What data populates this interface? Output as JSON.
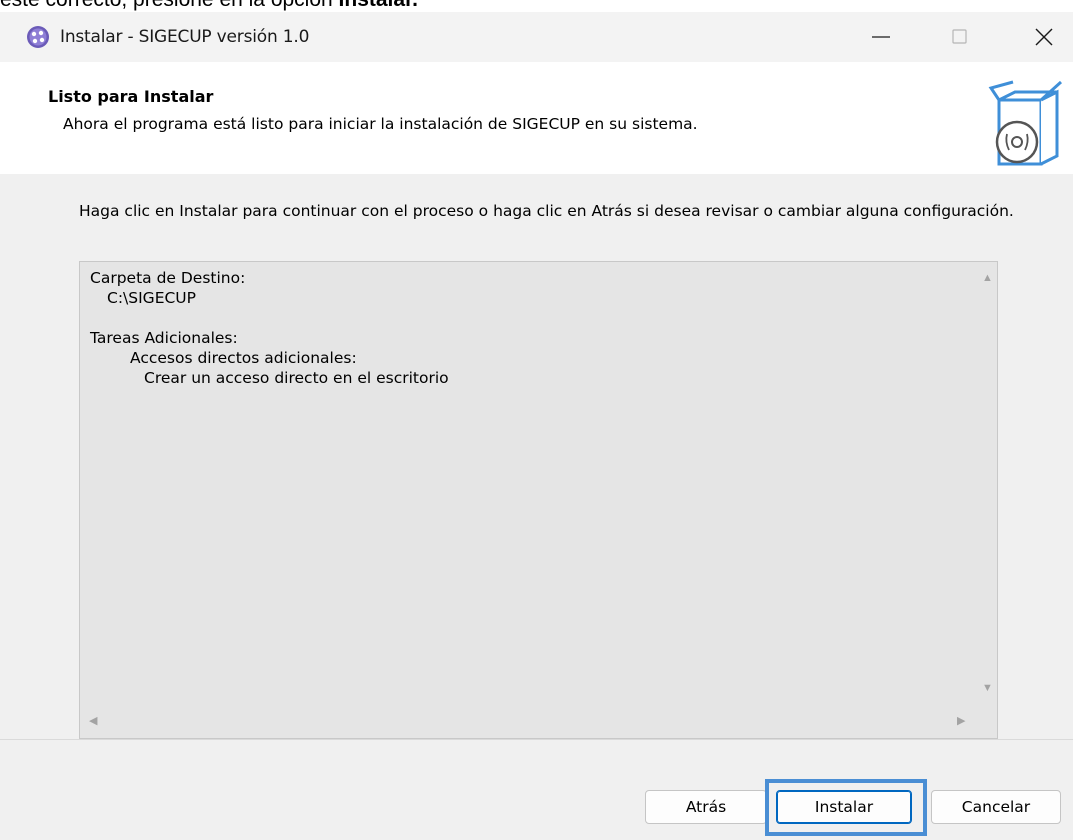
{
  "caption": {
    "before": "esté correcto, presione en la opción ",
    "bold": "Instalar."
  },
  "window": {
    "title": "Instalar - SIGECUP versión 1.0",
    "controls": {
      "minimize": "minimize-icon",
      "maximize": "maximize-icon",
      "close": "close-icon"
    }
  },
  "header": {
    "title": "Listo para Instalar",
    "description": "Ahora el programa está listo para iniciar la instalación de SIGECUP en su sistema."
  },
  "body": {
    "instruction": "Haga clic en Instalar para continuar con el proceso o haga clic en Atrás si desea revisar o cambiar alguna configuración.",
    "memo": {
      "dest_label": "Carpeta de Destino:",
      "dest_value": "C:\\SIGECUP",
      "tasks_label": "Tareas Adicionales:",
      "task_group": "Accesos directos adicionales:",
      "task_item": "Crear un acceso directo en el escritorio"
    }
  },
  "footer": {
    "back_label": "Atrás",
    "install_label": "Instalar",
    "cancel_label": "Cancelar"
  },
  "colors": {
    "accent": "#0067c0",
    "highlight": "#4a8ed4",
    "window_bg": "#f0f0f0",
    "memo_bg": "#e5e5e5"
  }
}
